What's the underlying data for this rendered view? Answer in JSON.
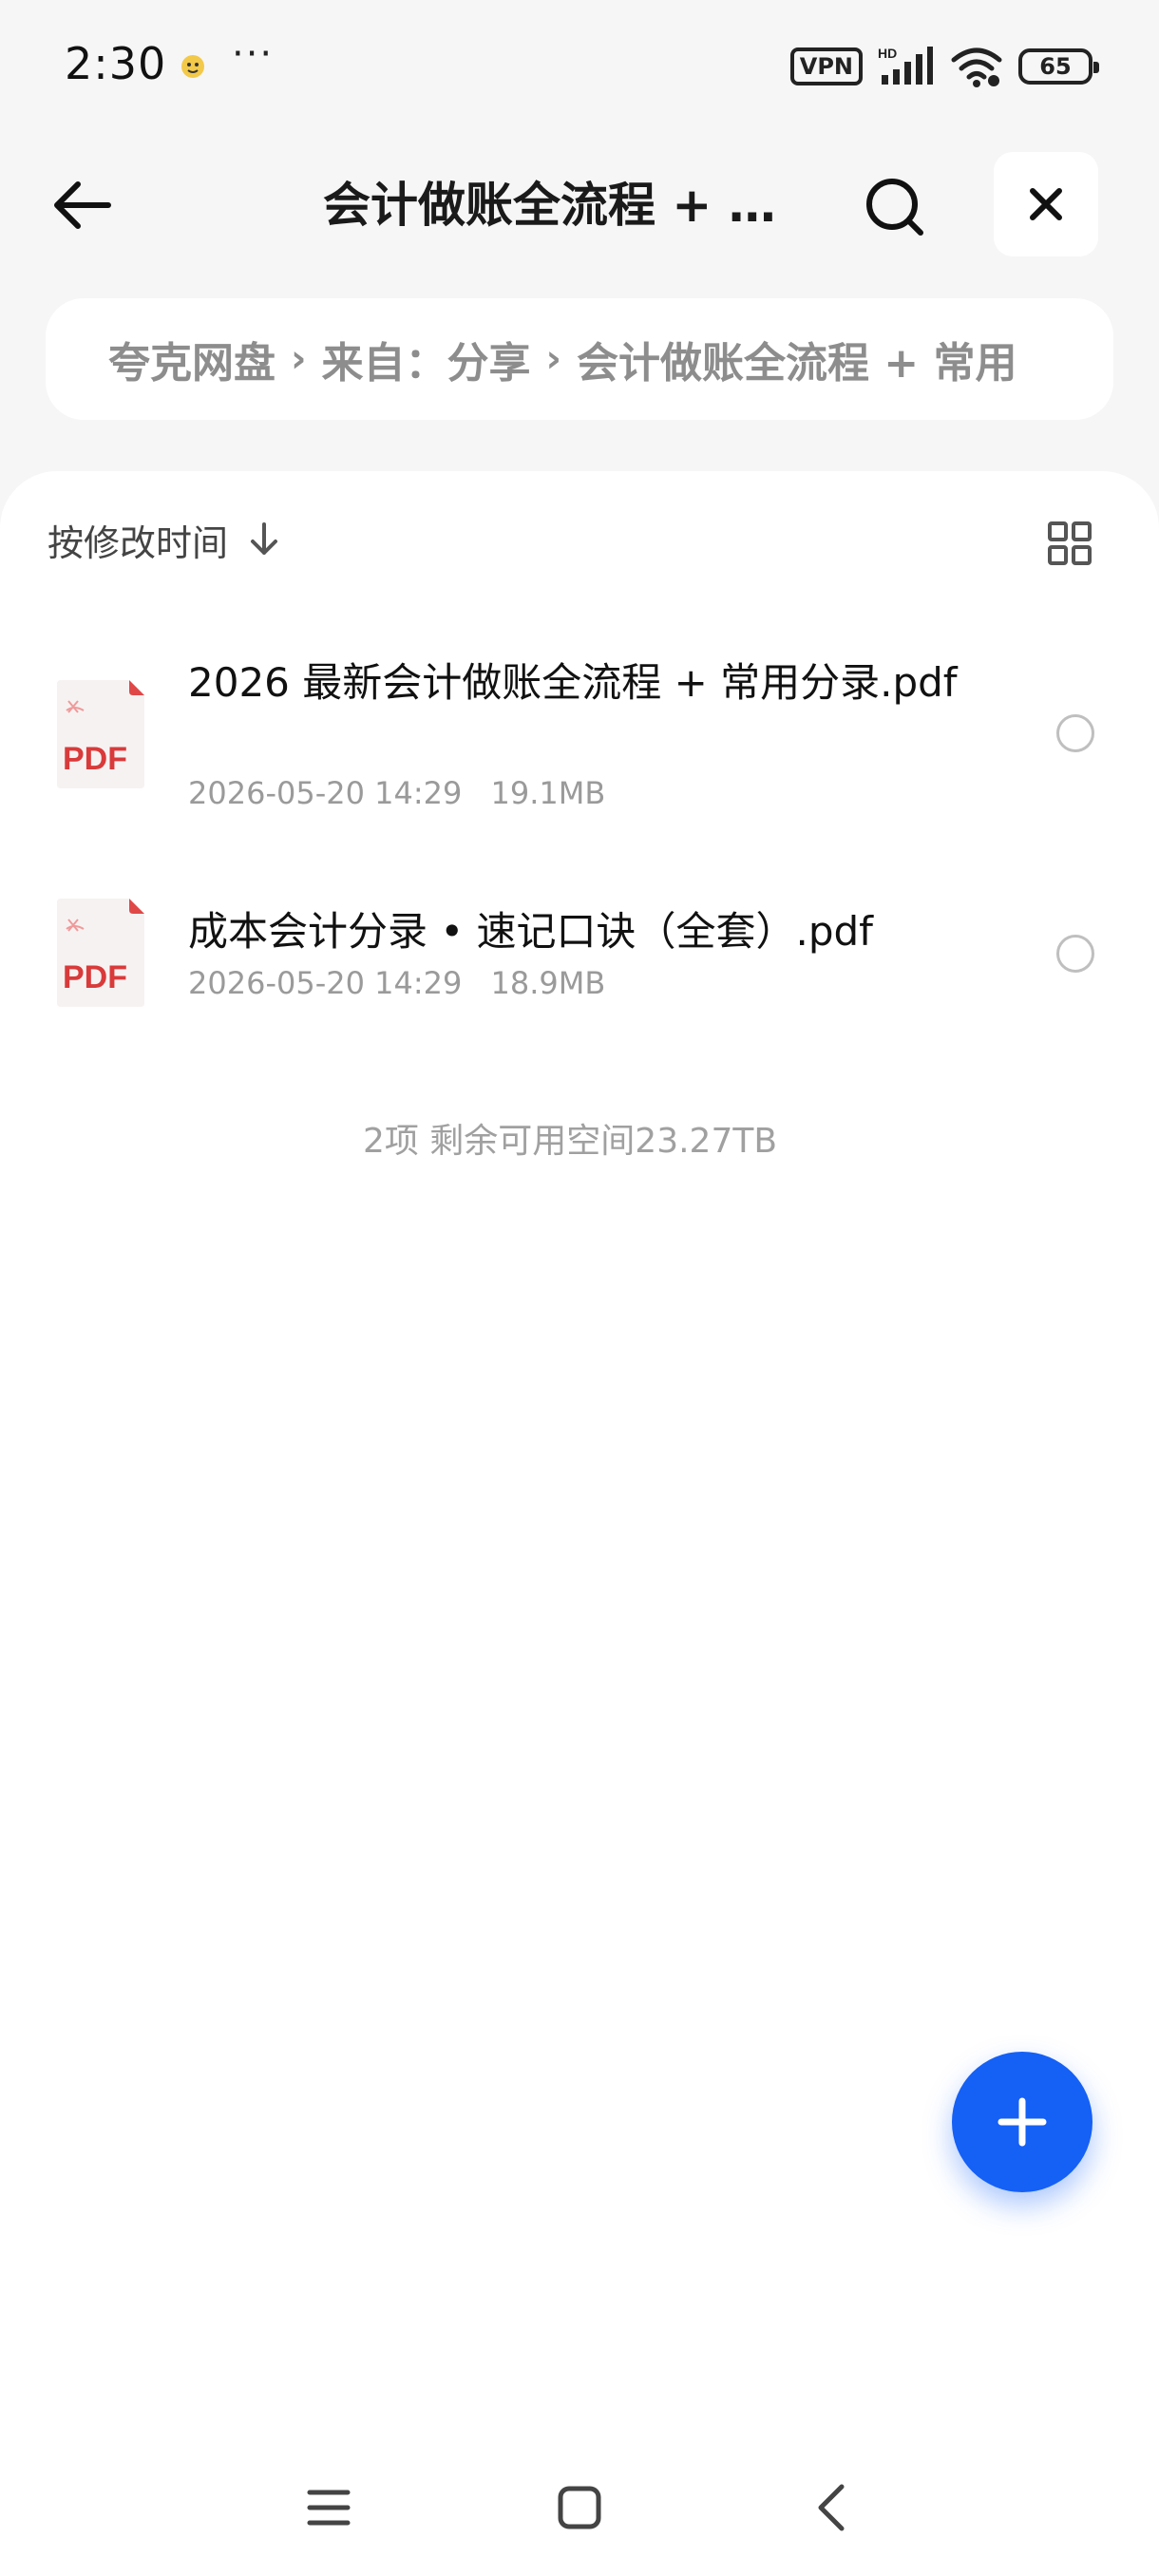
{
  "status_bar": {
    "time": "2:30",
    "more": "···",
    "vpn": "VPN",
    "battery": "65",
    "icons": [
      "notification-app-icon",
      "signal-hd-icon",
      "wifi-icon",
      "battery-icon"
    ]
  },
  "header": {
    "title": "会计做账全流程 + …",
    "back_icon": "arrow-left-icon",
    "search_icon": "search-icon",
    "close_icon": "close-icon"
  },
  "breadcrumb": {
    "items": [
      "夸克网盘",
      "来自：分享",
      "会计做账全流程 + 常用"
    ],
    "separator": "›"
  },
  "sort": {
    "label": "按修改时间",
    "direction_icon": "arrow-down-icon",
    "view_icon": "grid-view-icon"
  },
  "files": [
    {
      "name": "2026 最新会计做账全流程 + 常用分录.pdf",
      "date": "2026-05-20 14:29",
      "size": "19.1MB",
      "type": "PDF"
    },
    {
      "name": "成本会计分录 • 速记口诀（全套）.pdf",
      "date": "2026-05-20 14:29",
      "size": "18.9MB",
      "type": "PDF"
    }
  ],
  "summary": "2项 剩余可用空间23.27TB",
  "fab": {
    "icon": "plus-icon"
  },
  "colors": {
    "accent": "#1560f5",
    "pdf_red": "#d93a3a",
    "background": "#f6f6f6"
  }
}
